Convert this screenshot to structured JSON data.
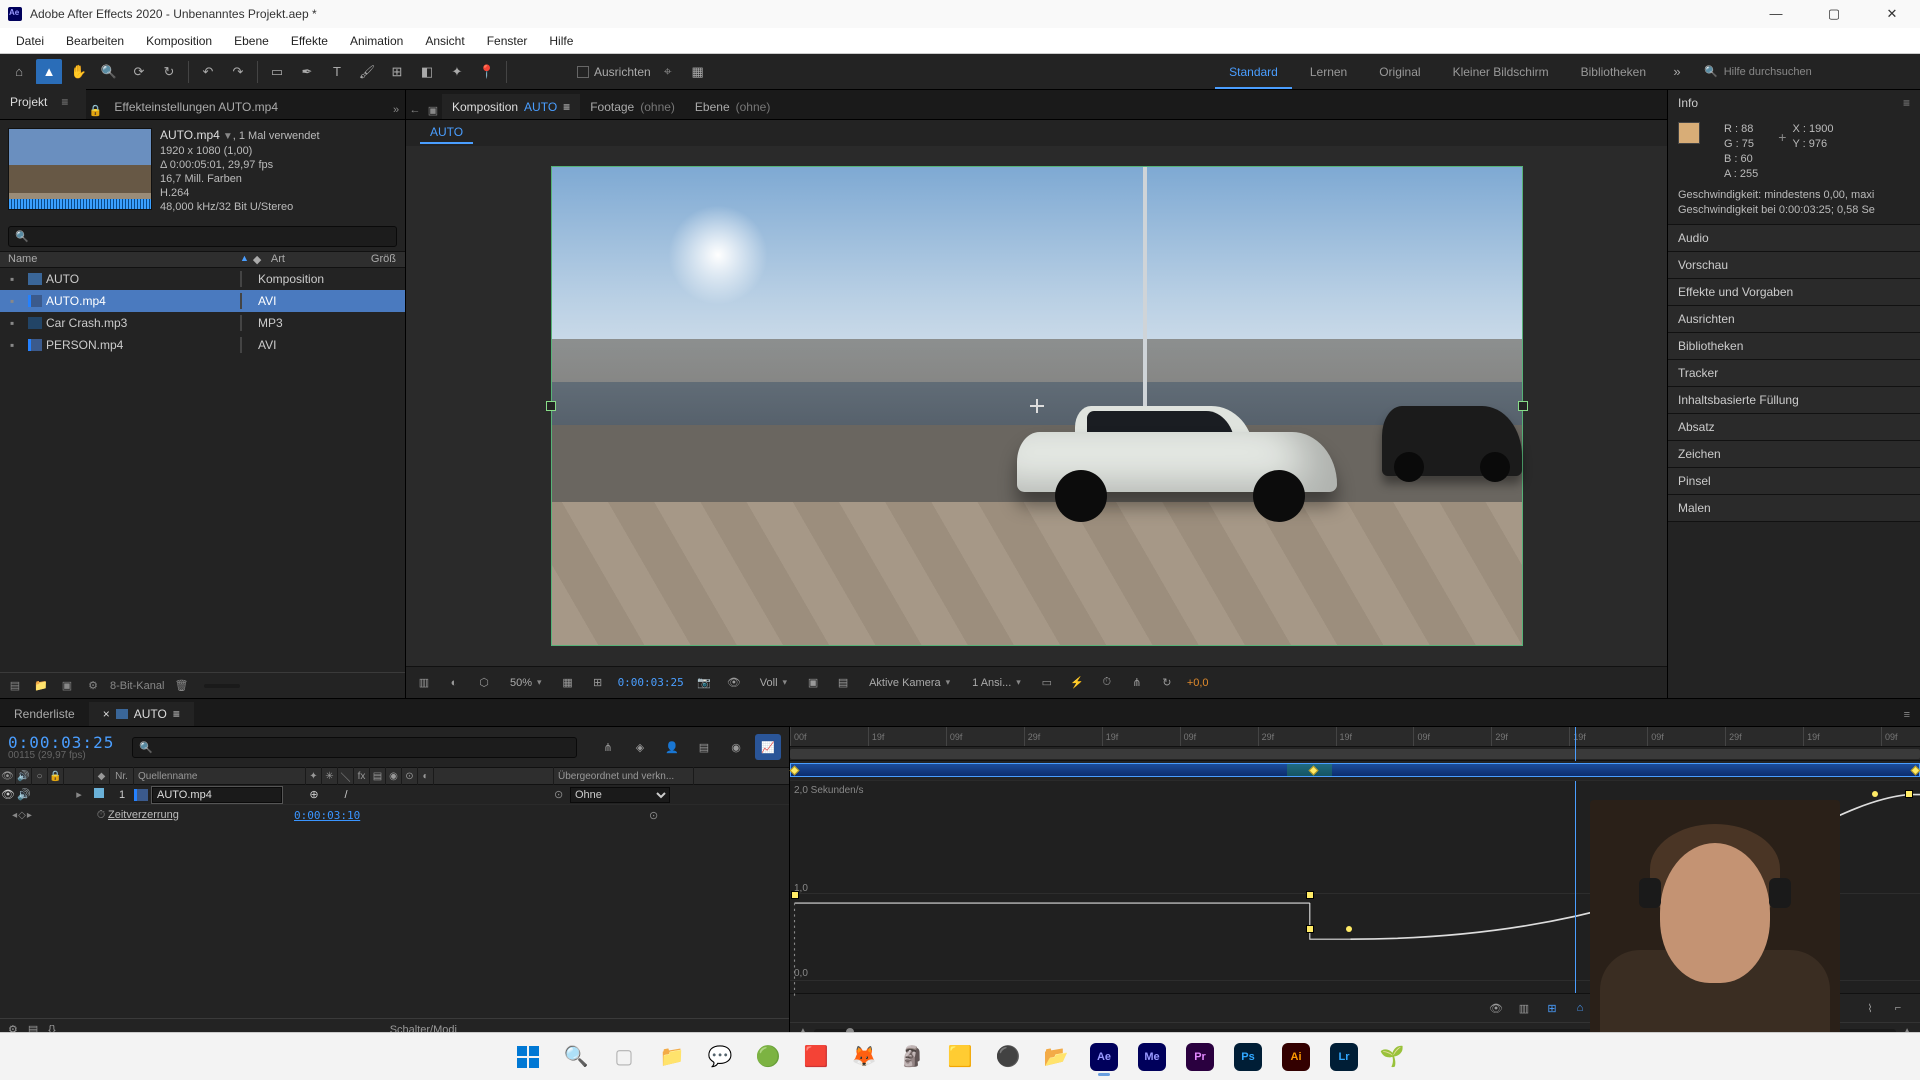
{
  "titlebar": {
    "title": "Adobe After Effects 2020 - Unbenanntes Projekt.aep *"
  },
  "menu": [
    "Datei",
    "Bearbeiten",
    "Komposition",
    "Ebene",
    "Effekte",
    "Animation",
    "Ansicht",
    "Fenster",
    "Hilfe"
  ],
  "toolbar": {
    "align_label": "Ausrichten",
    "workspaces": [
      "Standard",
      "Lernen",
      "Original",
      "Kleiner Bildschirm",
      "Bibliotheken"
    ],
    "search_placeholder": "Hilfe durchsuchen"
  },
  "project_panel": {
    "tab_project": "Projekt",
    "tab_effects": "Effekteinstellungen  AUTO.mp4",
    "item_name": "AUTO.mp4",
    "item_uses": ", 1 Mal verwendet",
    "meta": [
      "1920 x 1080 (1,00)",
      "Δ 0:00:05:01, 29,97 fps",
      "16,7 Mill. Farben",
      "H.264",
      "48,000 kHz/32 Bit U/Stereo"
    ],
    "cols": {
      "name": "Name",
      "type": "Art",
      "size": "Größ"
    },
    "items": [
      {
        "name": "AUTO",
        "type": "Komposition",
        "kind": "comp"
      },
      {
        "name": "AUTO.mp4",
        "type": "AVI",
        "kind": "video",
        "selected": true
      },
      {
        "name": "Car Crash.mp3",
        "type": "MP3",
        "kind": "audio"
      },
      {
        "name": "PERSON.mp4",
        "type": "AVI",
        "kind": "video"
      }
    ],
    "footer_depth": "8-Bit-Kanal"
  },
  "comp_panel": {
    "tabs": {
      "comp_prefix": "Komposition",
      "comp_name": "AUTO",
      "footage": "Footage",
      "footage_value": "(ohne)",
      "layer": "Ebene",
      "layer_value": "(ohne)"
    },
    "breadcrumb": "AUTO",
    "footer": {
      "zoom": "50%",
      "time": "0:00:03:25",
      "res": "Voll",
      "camera": "Aktive Kamera",
      "views": "1 Ansi...",
      "offset": "+0,0"
    }
  },
  "info": {
    "title": "Info",
    "r": "88",
    "g": "75",
    "b": "60",
    "a": "255",
    "x": "1900",
    "y": "976",
    "speed1": "Geschwindigkeit: mindestens 0,00, maxi",
    "speed2": "Geschwindigkeit bei 0:00:03:25; 0,58 Se"
  },
  "right_panels": [
    "Audio",
    "Vorschau",
    "Effekte und Vorgaben",
    "Ausrichten",
    "Bibliotheken",
    "Tracker",
    "Inhaltsbasierte Füllung",
    "Absatz",
    "Zeichen",
    "Pinsel",
    "Malen"
  ],
  "timeline": {
    "tabs": {
      "render": "Renderliste",
      "comp": "AUTO"
    },
    "timecode": "0:00:03:25",
    "timecode_sub": "00115 (29,97 fps)",
    "cols": {
      "nr": "Nr.",
      "source": "Quellenname",
      "parent": "Übergeordnet und verkn..."
    },
    "layer": {
      "num": "1",
      "name": "AUTO.mp4",
      "parent": "Ohne"
    },
    "prop": {
      "name": "Zeitverzerrung",
      "value": "0:00:03:10"
    },
    "ruler_ticks": [
      "00f",
      "19f",
      "09f",
      "29f",
      "19f",
      "09f",
      "29f",
      "19f",
      "09f",
      "29f",
      "19f",
      "09f",
      "29f",
      "19f",
      "09f"
    ],
    "graph_labels": {
      "top": "2,0 Sekunden/s",
      "mid": "1,0",
      "bot": "0,0"
    },
    "footer_label": "Schalter/Modi"
  },
  "colors": {
    "accent": "#4a9eff",
    "orange": "#e08a2c"
  }
}
